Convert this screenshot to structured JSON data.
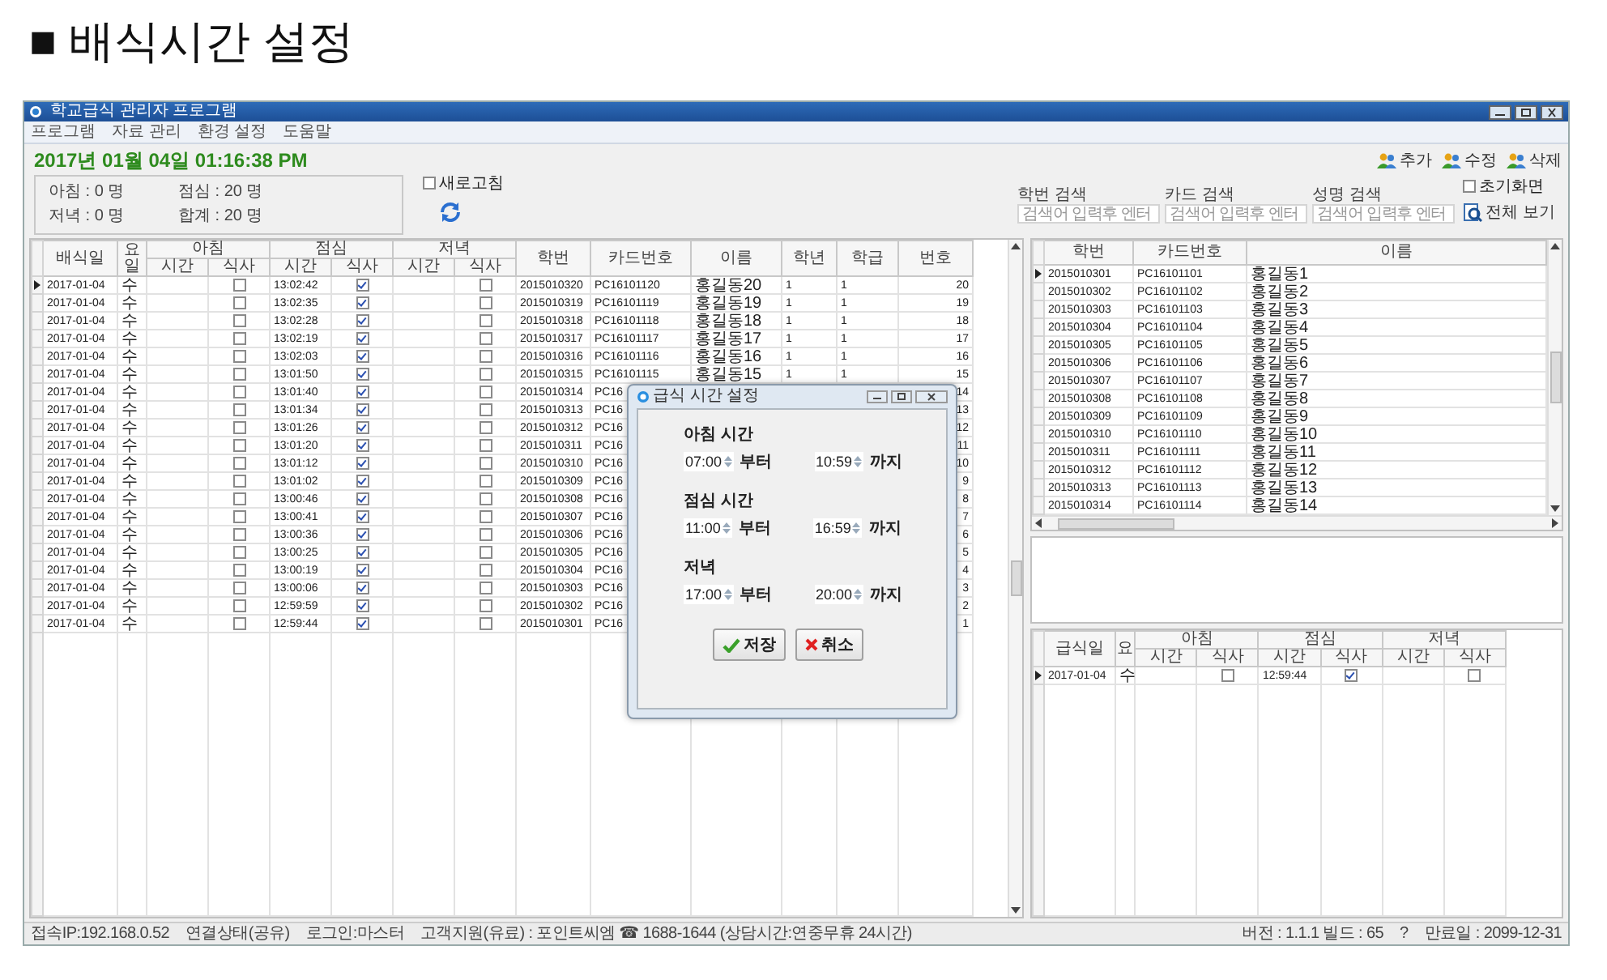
{
  "heading": "■ 배식시간 설정",
  "window": {
    "title": "학교급식 관리자 프로그램"
  },
  "menu": [
    "프로그램",
    "자료 관리",
    "환경 설정",
    "도움말"
  ],
  "clock": "2017년 01월 04일 01:16:38 PM",
  "counts": [
    "아침 : 0 명",
    "점심 : 20 명",
    "저녁 : 0 명",
    "합계 : 20 명"
  ],
  "auto_refresh": {
    "label": "새로고침",
    "checked": false
  },
  "meal_log": {
    "date_columns": [
      "배식일",
      "요일"
    ],
    "meal_groups": [
      {
        "name": "아침",
        "columns": [
          "시간",
          "식사"
        ]
      },
      {
        "name": "점심",
        "columns": [
          "시간",
          "식사"
        ]
      },
      {
        "name": "저녁",
        "columns": [
          "시간",
          "식사"
        ]
      }
    ],
    "student_columns": [
      "학번",
      "카드번호",
      "이름",
      "학년",
      "학급",
      "번호"
    ],
    "rows": [
      {
        "selected": true,
        "date": "2017-01-04",
        "day": "수",
        "meals": [
          {
            "eaten": false
          },
          {
            "time": "13:02:42",
            "eaten": true
          },
          {
            "eaten": false
          }
        ],
        "student": {
          "id": "2015010320",
          "card": "PC16101120",
          "name": "홍길동20",
          "grade": "1",
          "class": "1",
          "number": "20"
        }
      },
      {
        "selected": false,
        "date": "2017-01-04",
        "day": "수",
        "meals": [
          {
            "eaten": false
          },
          {
            "time": "13:02:35",
            "eaten": true
          },
          {
            "eaten": false
          }
        ],
        "student": {
          "id": "2015010319",
          "card": "PC16101119",
          "name": "홍길동19",
          "grade": "1",
          "class": "1",
          "number": "19"
        }
      },
      {
        "selected": false,
        "date": "2017-01-04",
        "day": "수",
        "meals": [
          {
            "eaten": false
          },
          {
            "time": "13:02:28",
            "eaten": true
          },
          {
            "eaten": false
          }
        ],
        "student": {
          "id": "2015010318",
          "card": "PC16101118",
          "name": "홍길동18",
          "grade": "1",
          "class": "1",
          "number": "18"
        }
      },
      {
        "selected": false,
        "date": "2017-01-04",
        "day": "수",
        "meals": [
          {
            "eaten": false
          },
          {
            "time": "13:02:19",
            "eaten": true
          },
          {
            "eaten": false
          }
        ],
        "student": {
          "id": "2015010317",
          "card": "PC16101117",
          "name": "홍길동17",
          "grade": "1",
          "class": "1",
          "number": "17"
        }
      },
      {
        "selected": false,
        "date": "2017-01-04",
        "day": "수",
        "meals": [
          {
            "eaten": false
          },
          {
            "time": "13:02:03",
            "eaten": true
          },
          {
            "eaten": false
          }
        ],
        "student": {
          "id": "2015010316",
          "card": "PC16101116",
          "name": "홍길동16",
          "grade": "1",
          "class": "1",
          "number": "16"
        }
      },
      {
        "selected": false,
        "date": "2017-01-04",
        "day": "수",
        "meals": [
          {
            "eaten": false
          },
          {
            "time": "13:01:50",
            "eaten": true
          },
          {
            "eaten": false
          }
        ],
        "student": {
          "id": "2015010315",
          "card": "PC16101115",
          "name": "홍길동15",
          "grade": "1",
          "class": "1",
          "number": "15"
        }
      },
      {
        "selected": false,
        "date": "2017-01-04",
        "day": "수",
        "meals": [
          {
            "eaten": false
          },
          {
            "time": "13:01:40",
            "eaten": true
          },
          {
            "eaten": false
          }
        ],
        "student": {
          "id": "2015010314",
          "card": "PC16",
          "number": "14"
        }
      },
      {
        "selected": false,
        "date": "2017-01-04",
        "day": "수",
        "meals": [
          {
            "eaten": false
          },
          {
            "time": "13:01:34",
            "eaten": true
          },
          {
            "eaten": false
          }
        ],
        "student": {
          "id": "2015010313",
          "card": "PC16",
          "number": "13"
        }
      },
      {
        "selected": false,
        "date": "2017-01-04",
        "day": "수",
        "meals": [
          {
            "eaten": false
          },
          {
            "time": "13:01:26",
            "eaten": true
          },
          {
            "eaten": false
          }
        ],
        "student": {
          "id": "2015010312",
          "card": "PC16",
          "number": "12"
        }
      },
      {
        "selected": false,
        "date": "2017-01-04",
        "day": "수",
        "meals": [
          {
            "eaten": false
          },
          {
            "time": "13:01:20",
            "eaten": true
          },
          {
            "eaten": false
          }
        ],
        "student": {
          "id": "2015010311",
          "card": "PC16",
          "number": "11"
        }
      },
      {
        "selected": false,
        "date": "2017-01-04",
        "day": "수",
        "meals": [
          {
            "eaten": false
          },
          {
            "time": "13:01:12",
            "eaten": true
          },
          {
            "eaten": false
          }
        ],
        "student": {
          "id": "2015010310",
          "card": "PC16",
          "number": "10"
        }
      },
      {
        "selected": false,
        "date": "2017-01-04",
        "day": "수",
        "meals": [
          {
            "eaten": false
          },
          {
            "time": "13:01:02",
            "eaten": true
          },
          {
            "eaten": false
          }
        ],
        "student": {
          "id": "2015010309",
          "card": "PC16",
          "number": "9"
        }
      },
      {
        "selected": false,
        "date": "2017-01-04",
        "day": "수",
        "meals": [
          {
            "eaten": false
          },
          {
            "time": "13:00:46",
            "eaten": true
          },
          {
            "eaten": false
          }
        ],
        "student": {
          "id": "2015010308",
          "card": "PC16",
          "number": "8"
        }
      },
      {
        "selected": false,
        "date": "2017-01-04",
        "day": "수",
        "meals": [
          {
            "eaten": false
          },
          {
            "time": "13:00:41",
            "eaten": true
          },
          {
            "eaten": false
          }
        ],
        "student": {
          "id": "2015010307",
          "card": "PC16",
          "number": "7"
        }
      },
      {
        "selected": false,
        "date": "2017-01-04",
        "day": "수",
        "meals": [
          {
            "eaten": false
          },
          {
            "time": "13:00:36",
            "eaten": true
          },
          {
            "eaten": false
          }
        ],
        "student": {
          "id": "2015010306",
          "card": "PC16",
          "number": "6"
        }
      },
      {
        "selected": false,
        "date": "2017-01-04",
        "day": "수",
        "meals": [
          {
            "eaten": false
          },
          {
            "time": "13:00:25",
            "eaten": true
          },
          {
            "eaten": false
          }
        ],
        "student": {
          "id": "2015010305",
          "card": "PC16",
          "number": "5"
        }
      },
      {
        "selected": false,
        "date": "2017-01-04",
        "day": "수",
        "meals": [
          {
            "eaten": false
          },
          {
            "time": "13:00:19",
            "eaten": true
          },
          {
            "eaten": false
          }
        ],
        "student": {
          "id": "2015010304",
          "card": "PC16",
          "number": "4"
        }
      },
      {
        "selected": false,
        "date": "2017-01-04",
        "day": "수",
        "meals": [
          {
            "eaten": false
          },
          {
            "time": "13:00:06",
            "eaten": true
          },
          {
            "eaten": false
          }
        ],
        "student": {
          "id": "2015010303",
          "card": "PC16",
          "number": "3"
        }
      },
      {
        "selected": false,
        "date": "2017-01-04",
        "day": "수",
        "meals": [
          {
            "eaten": false
          },
          {
            "time": "12:59:59",
            "eaten": true
          },
          {
            "eaten": false
          }
        ],
        "student": {
          "id": "2015010302",
          "card": "PC16",
          "number": "2"
        }
      },
      {
        "selected": false,
        "date": "2017-01-04",
        "day": "수",
        "meals": [
          {
            "eaten": false
          },
          {
            "time": "12:59:44",
            "eaten": true
          },
          {
            "eaten": false
          }
        ],
        "student": {
          "id": "2015010301",
          "card": "PC16",
          "number": "1"
        }
      }
    ]
  },
  "actions": [
    "추가",
    "수정",
    "삭제"
  ],
  "searches": [
    {
      "label": "학번 검색",
      "placeholder": "검색어 입력후 엔터"
    },
    {
      "label": "카드 검색",
      "placeholder": "검색어 입력후 엔터"
    },
    {
      "label": "성명 검색",
      "placeholder": "검색어 입력후 엔터"
    }
  ],
  "option": {
    "label": "초기화면",
    "checked": false
  },
  "view_all": "전체 보기",
  "students": {
    "columns": [
      "학번",
      "카드번호",
      "이름"
    ],
    "rows": [
      {
        "selected": true,
        "cells": [
          "2015010301",
          "PC16101101",
          "홍길동1"
        ]
      },
      {
        "selected": false,
        "cells": [
          "2015010302",
          "PC16101102",
          "홍길동2"
        ]
      },
      {
        "selected": false,
        "cells": [
          "2015010303",
          "PC16101103",
          "홍길동3"
        ]
      },
      {
        "selected": false,
        "cells": [
          "2015010304",
          "PC16101104",
          "홍길동4"
        ]
      },
      {
        "selected": false,
        "cells": [
          "2015010305",
          "PC16101105",
          "홍길동5"
        ]
      },
      {
        "selected": false,
        "cells": [
          "2015010306",
          "PC16101106",
          "홍길동6"
        ]
      },
      {
        "selected": false,
        "cells": [
          "2015010307",
          "PC16101107",
          "홍길동7"
        ]
      },
      {
        "selected": false,
        "cells": [
          "2015010308",
          "PC16101108",
          "홍길동8"
        ]
      },
      {
        "selected": false,
        "cells": [
          "2015010309",
          "PC16101109",
          "홍길동9"
        ]
      },
      {
        "selected": false,
        "cells": [
          "2015010310",
          "PC16101110",
          "홍길동10"
        ]
      },
      {
        "selected": false,
        "cells": [
          "2015010311",
          "PC16101111",
          "홍길동11"
        ]
      },
      {
        "selected": false,
        "cells": [
          "2015010312",
          "PC16101112",
          "홍길동12"
        ]
      },
      {
        "selected": false,
        "cells": [
          "2015010313",
          "PC16101113",
          "홍길동13"
        ]
      },
      {
        "selected": false,
        "cells": [
          "2015010314",
          "PC16101114",
          "홍길동14"
        ]
      }
    ]
  },
  "history": {
    "date_columns": [
      "급식일",
      "요"
    ],
    "meal_groups": [
      {
        "name": "아침",
        "columns": [
          "시간",
          "식사"
        ]
      },
      {
        "name": "점심",
        "columns": [
          "시간",
          "식사"
        ]
      },
      {
        "name": "저녁",
        "columns": [
          "시간",
          "식사"
        ]
      }
    ],
    "rows": [
      {
        "selected": true,
        "date": "2017-01-04",
        "day": "수",
        "meals": [
          {
            "eaten": false
          },
          {
            "time": "12:59:44",
            "eaten": true
          },
          {
            "eaten": false
          }
        ]
      }
    ]
  },
  "dialog": {
    "title": "급식 시간 설정",
    "periods": [
      {
        "label": "아침 시간",
        "from": "07:00",
        "from_word": "부터",
        "to": "10:59",
        "to_word": "까지"
      },
      {
        "label": "점심 시간",
        "from": "11:00",
        "from_word": "부터",
        "to": "16:59",
        "to_word": "까지"
      },
      {
        "label": "저녁",
        "from": "17:00",
        "from_word": "부터",
        "to": "20:00",
        "to_word": "까지"
      }
    ],
    "buttons": [
      {
        "label": "저장",
        "kind": "save"
      },
      {
        "label": "취소",
        "kind": "cancel"
      }
    ]
  },
  "status_bar": {
    "left": [
      "접속IP:192.168.0.52",
      "연결상태(공유)",
      "로그인:마스터",
      "고객지원(유료) : 포인트씨엠 ☎ 1688-1644 (상담시간:연중무휴 24시간)"
    ],
    "right": [
      "버전 : 1.1.1 빌드 : 65",
      "?",
      "만료일 : 2099-12-31"
    ]
  }
}
